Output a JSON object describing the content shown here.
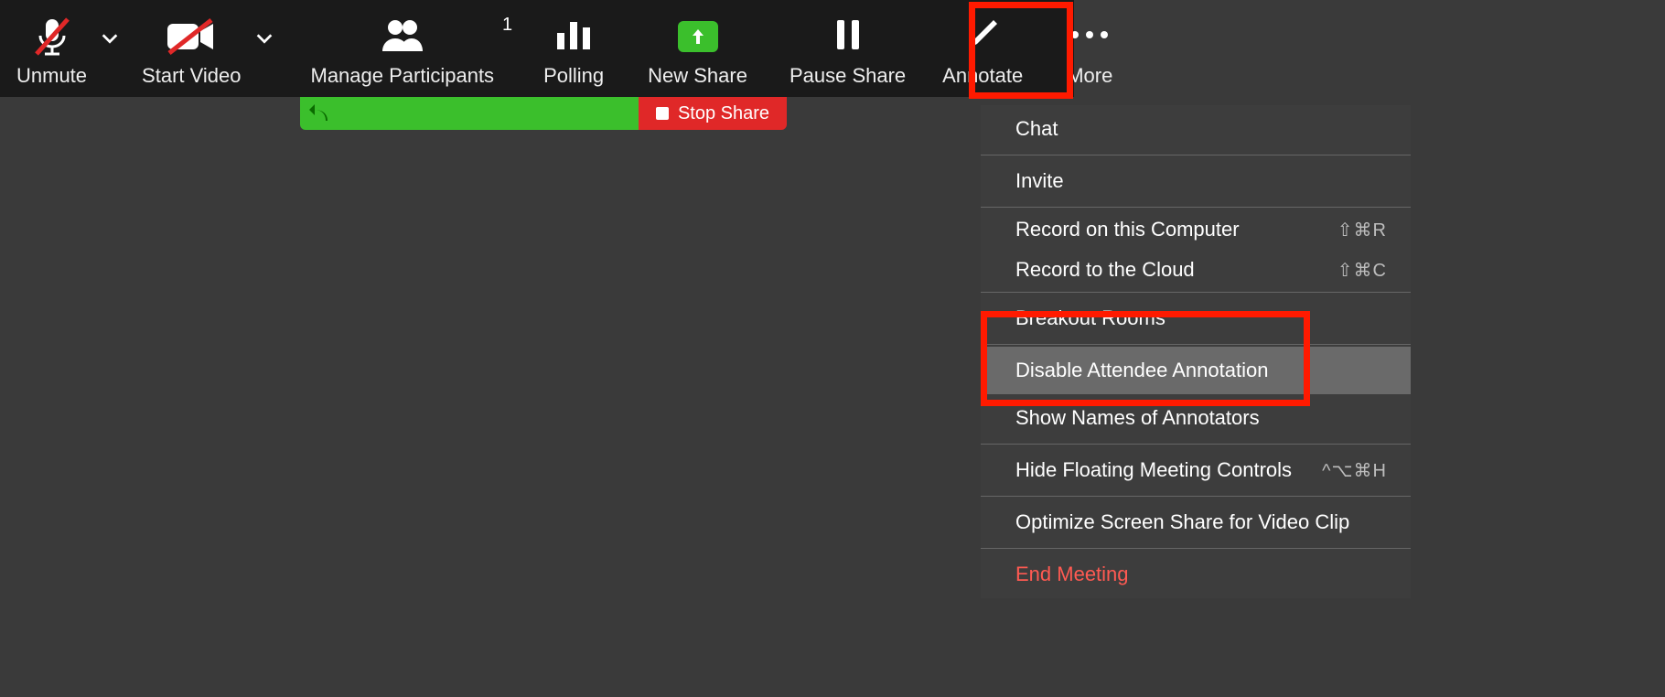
{
  "toolbar": {
    "unmute": "Unmute",
    "start_video": "Start Video",
    "manage_participants": "Manage Participants",
    "participants_count": "1",
    "polling": "Polling",
    "new_share": "New Share",
    "pause_share": "Pause Share",
    "annotate": "Annotate",
    "more": "More"
  },
  "share_bar": {
    "stop_share": "Stop Share"
  },
  "more_menu": {
    "chat": "Chat",
    "invite": "Invite",
    "record_computer": "Record on this Computer",
    "record_computer_key": "⇧⌘R",
    "record_cloud": "Record to the Cloud",
    "record_cloud_key": "⇧⌘C",
    "breakout": "Breakout Rooms",
    "disable_annotation": "Disable Attendee Annotation",
    "show_names": "Show Names of Annotators",
    "hide_controls": "Hide Floating Meeting Controls",
    "hide_controls_key": "^⌥⌘H",
    "optimize": "Optimize Screen Share for Video Clip",
    "end_meeting": "End Meeting"
  }
}
